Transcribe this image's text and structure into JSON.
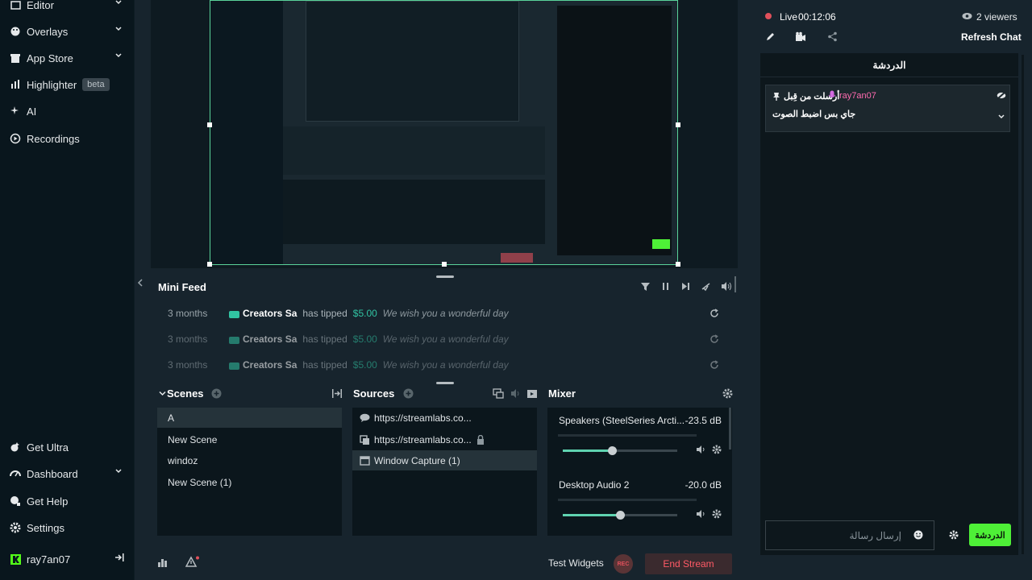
{
  "sidebar": {
    "items": [
      {
        "label": "Editor"
      },
      {
        "label": "Overlays"
      },
      {
        "label": "App Store"
      },
      {
        "label": "Highlighter",
        "badge": "beta"
      },
      {
        "label": "AI"
      },
      {
        "label": "Recordings"
      }
    ],
    "bottom": [
      {
        "label": "Get Ultra"
      },
      {
        "label": "Dashboard"
      },
      {
        "label": "Get Help"
      },
      {
        "label": "Settings"
      }
    ],
    "user": "ray7an07"
  },
  "minifeed": {
    "title": "Mini Feed",
    "rows": [
      {
        "time": "3 months",
        "user": "Creators Sa",
        "action": "has tipped",
        "amount": "$5.00",
        "message": "We wish you a wonderful day"
      },
      {
        "time": "3 months",
        "user": "Creators Sa",
        "action": "has tipped",
        "amount": "$5.00",
        "message": "We wish you a wonderful day"
      },
      {
        "time": "3 months",
        "user": "Creators Sa",
        "action": "has tipped",
        "amount": "$5.00",
        "message": "We wish you a wonderful day"
      }
    ]
  },
  "scenes": {
    "title": "Scenes",
    "items": [
      "A",
      "New Scene",
      "windoz",
      "New Scene (1)"
    ],
    "selected_index": 0
  },
  "sources": {
    "title": "Sources",
    "items": [
      "https://streamlabs.co...",
      "https://streamlabs.co...",
      "Window Capture (1)"
    ],
    "selected_index": 2
  },
  "mixer": {
    "title": "Mixer",
    "channels": [
      {
        "name": "Speakers (SteelSeries Arcti...",
        "db": "-23.5 dB",
        "level": 0.43
      },
      {
        "name": "Desktop Audio 2",
        "db": "-20.0 dB",
        "level": 0.5
      }
    ]
  },
  "footer": {
    "test_widgets": "Test Widgets",
    "rec": "REC",
    "end_stream": "End Stream"
  },
  "chat": {
    "live_label": "Live",
    "live_time": "00:12:06",
    "viewers": "2 viewers",
    "refresh": "Refresh Chat",
    "header": "الدردشة",
    "pinned_user": "ray7an07",
    "pinned_label": "أرسلت من قِبل",
    "pinned_message": "جاي بس اضبط الصوت",
    "input_placeholder": "إرسال رسالة",
    "send": "الدردشة"
  },
  "colors": {
    "accent": "#31c3a2",
    "send_button": "#4ef037",
    "end_stream": "#e0505b",
    "live_dot": "#e0505b"
  }
}
